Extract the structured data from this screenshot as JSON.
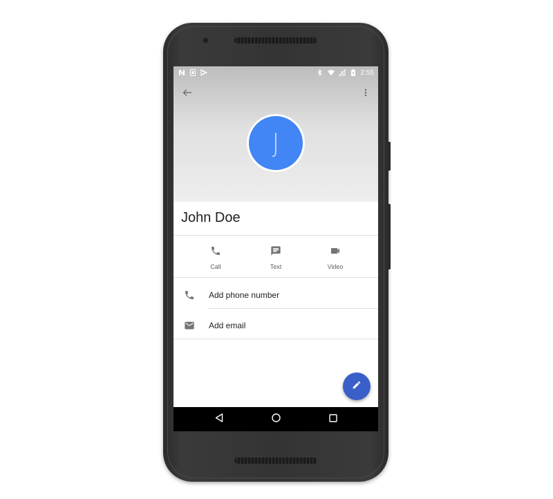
{
  "device": {
    "name": "phone"
  },
  "statusbar": {
    "left_icons": [
      "n-icon",
      "sim-icon",
      "play-store-icon"
    ],
    "right_icons": [
      "bluetooth-icon",
      "wifi-icon",
      "no-signal-icon",
      "battery-icon"
    ],
    "time": "2:55"
  },
  "toolbar": {
    "back_icon": "arrow-left-icon",
    "more_icon": "more-vert-icon"
  },
  "contact": {
    "initial": "J",
    "name": "John Doe",
    "avatar_color": "#4285f4"
  },
  "actions": [
    {
      "label": "Call",
      "icon": "phone-icon"
    },
    {
      "label": "Text",
      "icon": "message-icon"
    },
    {
      "label": "Video",
      "icon": "videocam-icon"
    }
  ],
  "fields": [
    {
      "label": "Add phone number",
      "icon": "phone-icon"
    },
    {
      "label": "Add email",
      "icon": "email-icon"
    }
  ],
  "fab": {
    "icon": "edit-pencil-icon",
    "color": "#3b5fc8"
  },
  "navbar": {
    "buttons": [
      "back-triangle-icon",
      "home-circle-icon",
      "recents-square-icon"
    ]
  }
}
